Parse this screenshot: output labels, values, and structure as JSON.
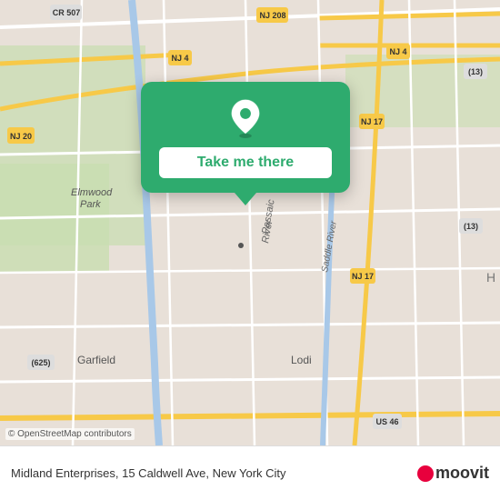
{
  "map": {
    "copyright": "© OpenStreetMap contributors",
    "background_color": "#e8e0d8"
  },
  "card": {
    "button_label": "Take me there",
    "pin_icon": "location-pin"
  },
  "bottom_bar": {
    "address": "Midland Enterprises, 15 Caldwell Ave, New York City",
    "logo_text": "moovit",
    "pin_icon": "location-pin-red"
  }
}
